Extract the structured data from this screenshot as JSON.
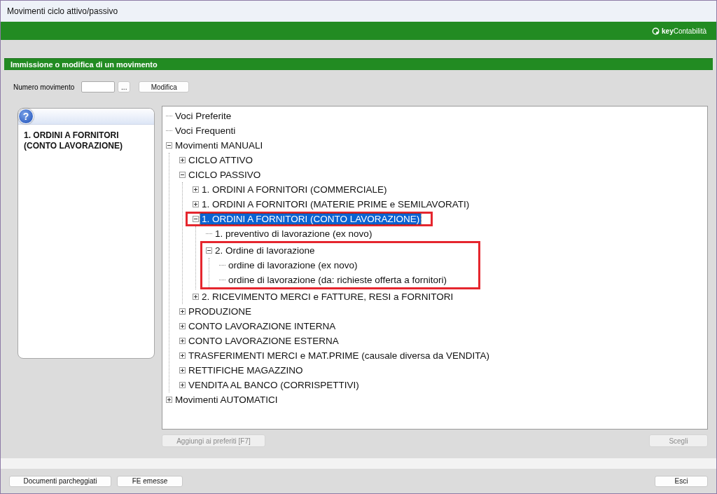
{
  "window": {
    "title": "Movimenti ciclo attivo/passivo"
  },
  "brand": {
    "logo": "**key**Contabilità"
  },
  "section": {
    "title": "Immissione o modifica di un movimento"
  },
  "numero": {
    "label": "Numero movimento",
    "browse_button": "...",
    "modify_button": "Modifica"
  },
  "help_panel": {
    "icon": "?",
    "text": "1. ORDINI A FORNITORI (CONTO LAVORAZIONE)"
  },
  "tree": [
    {
      "label": "Voci Preferite",
      "selected": false
    },
    {
      "label": "Voci Frequenti",
      "selected": false
    },
    {
      "label": "Movimenti MANUALI",
      "selected": false,
      "expanded": true,
      "children": [
        {
          "label": "CICLO ATTIVO",
          "selected": false,
          "expanded": false
        },
        {
          "label": "CICLO PASSIVO",
          "selected": false,
          "expanded": true,
          "children": [
            {
              "label": "1. ORDINI A FORNITORI (COMMERCIALE)",
              "selected": false,
              "expanded": false
            },
            {
              "label": "1. ORDINI A FORNITORI (MATERIE PRIME e SEMILAVORATI)",
              "selected": false,
              "expanded": false
            },
            {
              "label": "1. ORDINI A FORNITORI (CONTO LAVORAZIONE)",
              "selected": true,
              "expanded": true,
              "row_highlighted": true,
              "children": [
                {
                  "label": "1. preventivo di lavorazione (ex novo)",
                  "selected": false
                },
                {
                  "label": "2. Ordine di lavorazione",
                  "selected": false,
                  "expanded": true,
                  "group_highlighted": true,
                  "children": [
                    {
                      "label": "ordine di lavorazione (ex novo)",
                      "selected": false
                    },
                    {
                      "label": "ordine di lavorazione (da: richieste offerta a fornitori)",
                      "selected": false
                    }
                  ]
                }
              ]
            },
            {
              "label": "2. RICEVIMENTO MERCI e FATTURE,  RESI a FORNITORI",
              "selected": false,
              "expanded": false
            }
          ]
        },
        {
          "label": "PRODUZIONE",
          "selected": false,
          "expanded": false
        },
        {
          "label": "CONTO LAVORAZIONE INTERNA",
          "selected": false,
          "expanded": false
        },
        {
          "label": "CONTO LAVORAZIONE ESTERNA",
          "selected": false,
          "expanded": false
        },
        {
          "label": "TRASFERIMENTI MERCI e MAT.PRIME (causale diversa da VENDITA)",
          "selected": false,
          "expanded": false
        },
        {
          "label": "RETTIFICHE MAGAZZINO",
          "selected": false,
          "expanded": false
        },
        {
          "label": "VENDITA AL BANCO (CORRISPETTIVI)",
          "selected": false,
          "expanded": false
        }
      ]
    },
    {
      "label": "Movimenti AUTOMATICI",
      "selected": false,
      "expanded": false
    }
  ],
  "tree_buttons": [
    {
      "label": "Aggiungi ai preferiti [F7]",
      "disabled": true
    },
    {
      "label": "Scegli",
      "disabled": true
    }
  ],
  "footer_buttons": [
    {
      "label": "Documenti parcheggiati"
    },
    {
      "label": "FE emesse"
    },
    {
      "label": "Esci"
    }
  ]
}
